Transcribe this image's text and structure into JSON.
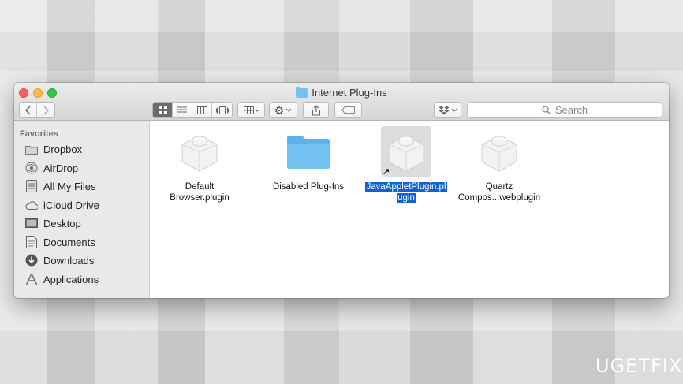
{
  "window": {
    "title": "Internet Plug-Ins"
  },
  "toolbar": {
    "back_icon": "chevron-left-icon",
    "forward_icon": "chevron-right-icon",
    "view_modes": [
      "icon-view",
      "list-view",
      "column-view",
      "cover-flow-view"
    ],
    "arrange_icon": "arrange-grid-icon",
    "action_icon": "gear-icon",
    "share_icon": "share-icon",
    "tags_icon": "tag-icon",
    "dropbox_icon": "dropbox-icon"
  },
  "search": {
    "placeholder": "Search"
  },
  "sidebar": {
    "section": "Favorites",
    "items": [
      {
        "label": "Dropbox",
        "icon": "folder-icon"
      },
      {
        "label": "AirDrop",
        "icon": "airdrop-icon"
      },
      {
        "label": "All My Files",
        "icon": "all-files-icon"
      },
      {
        "label": "iCloud Drive",
        "icon": "cloud-icon"
      },
      {
        "label": "Desktop",
        "icon": "desktop-icon"
      },
      {
        "label": "Documents",
        "icon": "documents-icon"
      },
      {
        "label": "Downloads",
        "icon": "downloads-icon"
      },
      {
        "label": "Applications",
        "icon": "applications-icon"
      }
    ]
  },
  "files": [
    {
      "line1": "Default",
      "line2": "Browser.plugin",
      "icon": "plugin-icon",
      "selected": false
    },
    {
      "line1": "Disabled Plug-Ins",
      "line2": "",
      "icon": "folder-icon",
      "selected": false
    },
    {
      "line1": "JavaAppletPlugin.pl",
      "line2": "ugin",
      "icon": "plugin-alias-icon",
      "selected": true
    },
    {
      "line1": "Quartz",
      "line2": "Compos...webplugin",
      "icon": "plugin-icon",
      "selected": false
    }
  ],
  "watermark": {
    "part1": "U",
    "part2": "G",
    "part3": "ET",
    "part4": "FIX"
  },
  "colors": {
    "selection": "#0f63d6",
    "folder": "#74c2f2"
  }
}
